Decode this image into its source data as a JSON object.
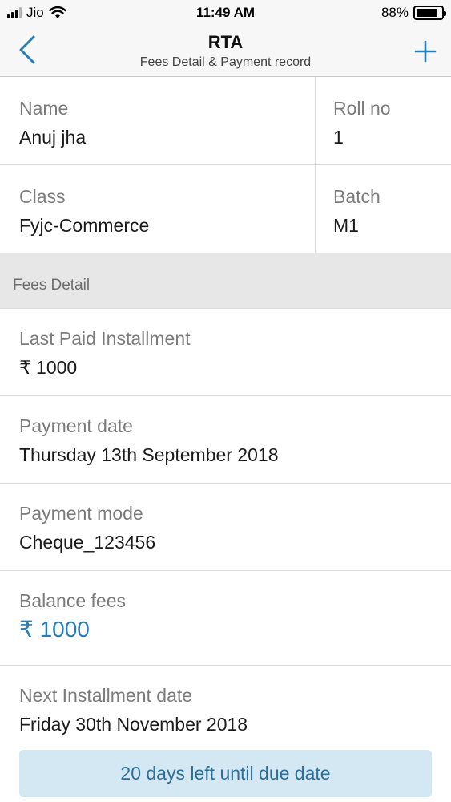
{
  "status_bar": {
    "carrier": "Jio",
    "time": "11:49 AM",
    "battery_percent": "88%",
    "battery_level": 0.88
  },
  "nav": {
    "title": "RTA",
    "subtitle": "Fees Detail & Payment record",
    "accent_color": "#2b7bb4"
  },
  "student": {
    "name_label": "Name",
    "name_value": "Anuj jha",
    "roll_label": "Roll no",
    "roll_value": "1",
    "class_label": "Class",
    "class_value": "Fyjc-Commerce",
    "batch_label": "Batch",
    "batch_value": "M1"
  },
  "fees": {
    "section_title": "Fees Detail",
    "items": [
      {
        "label": "Last Paid Installment",
        "value": "₹ 1000"
      },
      {
        "label": "Payment date",
        "value": "Thursday 13th September 2018"
      },
      {
        "label": "Payment mode",
        "value": "Cheque_123456"
      },
      {
        "label": "Balance fees",
        "value": "₹ 1000"
      },
      {
        "label": "Next Installment date",
        "value": "Friday 30th November 2018"
      }
    ],
    "due_banner": "20 days left until due date"
  }
}
